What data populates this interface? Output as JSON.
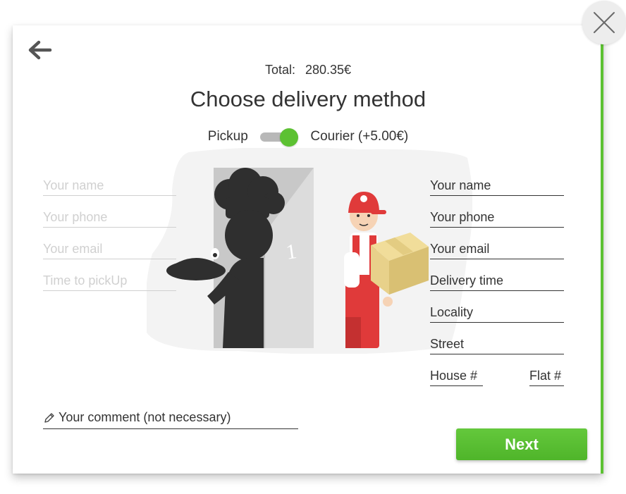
{
  "header": {
    "total_label": "Total:",
    "total_value": "280.35€",
    "title": "Choose delivery method"
  },
  "delivery_toggle": {
    "left_label": "Pickup",
    "right_label": "Courier (+5.00€)",
    "selected": "Courier",
    "active_color": "#5cc132"
  },
  "pickup_form": {
    "name_placeholder": "Your name",
    "phone_placeholder": "Your phone",
    "email_placeholder": "Your email",
    "time_placeholder": "Time to pickUp"
  },
  "courier_form": {
    "name_placeholder": "Your name",
    "phone_placeholder": "Your phone",
    "email_placeholder": "Your email",
    "time_placeholder": "Delivery time",
    "locality_placeholder": "Locality",
    "street_placeholder": "Street",
    "house_placeholder": "House #",
    "flat_placeholder": "Flat #"
  },
  "comment": {
    "placeholder": "Your comment (not necessary)"
  },
  "illustration": {
    "door_number": "1"
  },
  "footer": {
    "next_label": "Next",
    "button_color": "#5cc132"
  },
  "icons": {
    "back": "arrow-left-icon",
    "close": "close-icon",
    "comment": "pencil-icon"
  }
}
